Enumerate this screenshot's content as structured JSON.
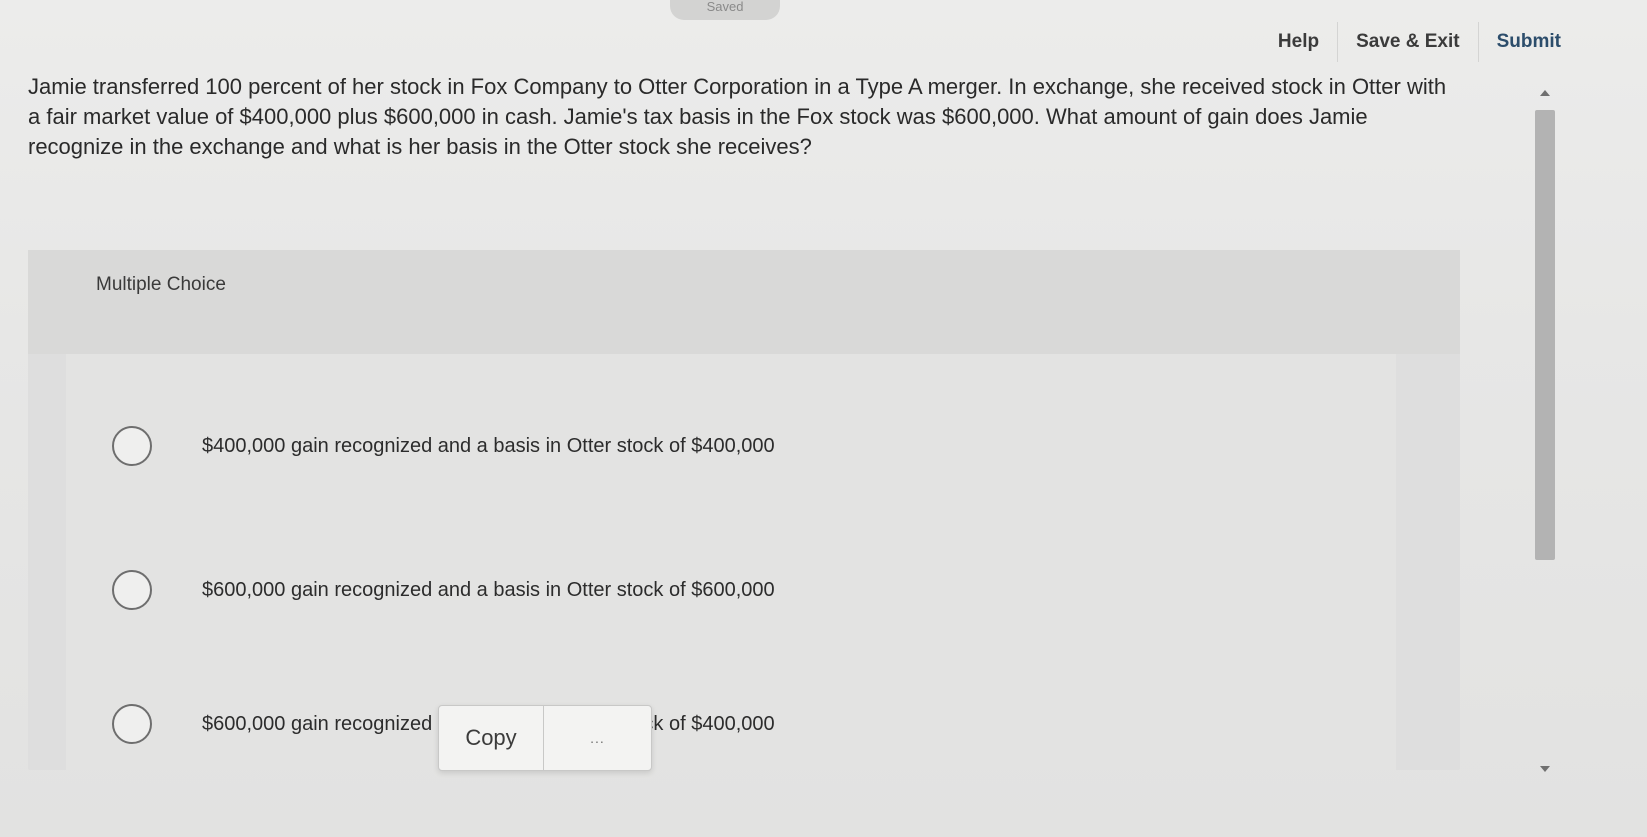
{
  "header": {
    "saved_status": "Saved",
    "help_label": "Help",
    "save_exit_label": "Save & Exit",
    "submit_label": "Submit"
  },
  "question": {
    "text": "Jamie transferred 100 percent of her stock in Fox Company to Otter Corporation in a Type A merger. In exchange, she received stock in Otter with a fair market value of $400,000 plus $600,000 in cash. Jamie's tax basis in the Fox stock was $600,000. What amount of gain does Jamie recognize in the exchange and what is her basis in the Otter stock she receives?"
  },
  "multiple_choice": {
    "label": "Multiple Choice",
    "options": [
      {
        "text": "$400,000 gain recognized and a basis in Otter stock of $400,000"
      },
      {
        "text": "$600,000 gain recognized and a basis in Otter stock of $600,000"
      },
      {
        "text": "$600,000 gain recognized and a basis in Otter stock of $400,000"
      }
    ]
  },
  "context_menu": {
    "copy_label": "Copy",
    "more_label": "..."
  },
  "colors": {
    "submit": "#2c4d6b",
    "panel": "#dedede",
    "scroll_thumb": "#b3b3b3"
  }
}
